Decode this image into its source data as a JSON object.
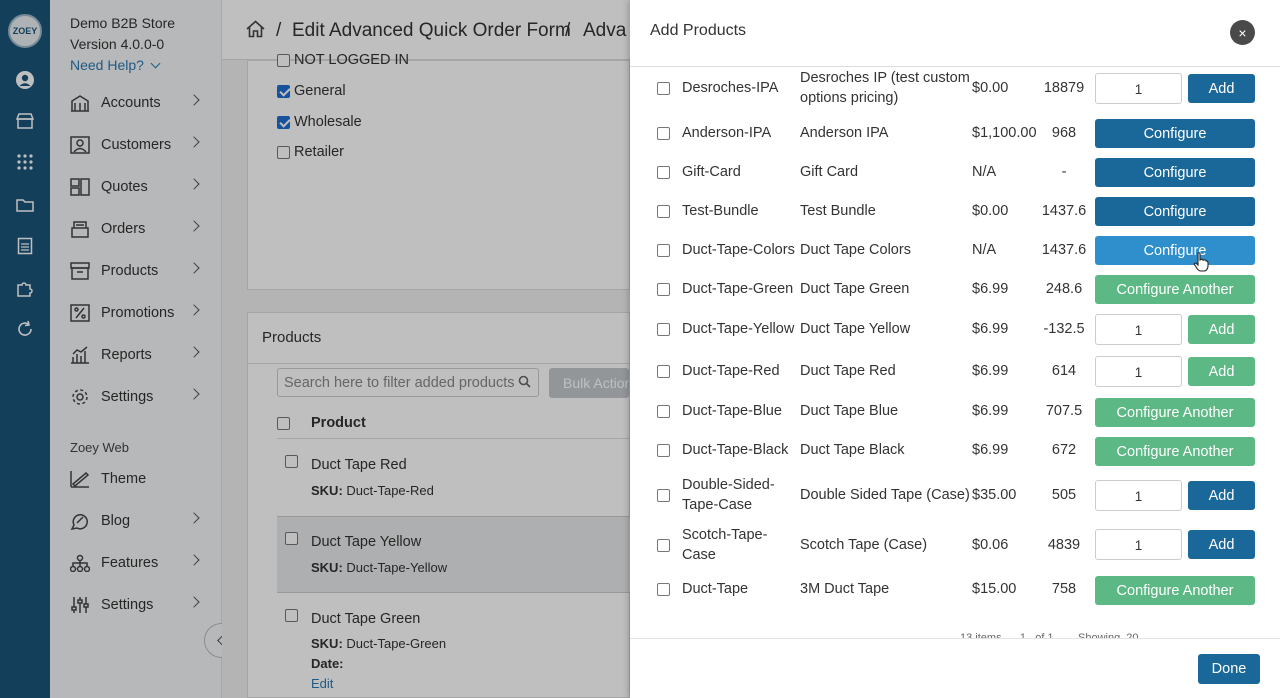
{
  "sidebar": {
    "store_name": "Demo B2B Store",
    "version": "Version 4.0.0-0",
    "help": "Need Help?",
    "logo_text": "ZOEY",
    "nav": [
      {
        "label": "Accounts",
        "icon": "accounts-icon"
      },
      {
        "label": "Customers",
        "icon": "customers-icon"
      },
      {
        "label": "Quotes",
        "icon": "quotes-icon"
      },
      {
        "label": "Orders",
        "icon": "orders-icon"
      },
      {
        "label": "Products",
        "icon": "products-icon"
      },
      {
        "label": "Promotions",
        "icon": "promotions-icon"
      },
      {
        "label": "Reports",
        "icon": "reports-icon"
      },
      {
        "label": "Settings",
        "icon": "settings-icon"
      }
    ],
    "web_section": "Zoey Web",
    "web_nav": [
      {
        "label": "Theme",
        "icon": "theme-icon"
      },
      {
        "label": "Blog",
        "icon": "blog-icon"
      },
      {
        "label": "Features",
        "icon": "features-icon"
      },
      {
        "label": "Settings",
        "icon": "sliders-icon"
      }
    ]
  },
  "breadcrumb": {
    "sep": "/",
    "page": "Edit Advanced Quick Order Form",
    "sub": "Adva"
  },
  "groups": {
    "items": [
      {
        "label": "NOT LOGGED IN",
        "checked": false
      },
      {
        "label": "General",
        "checked": true
      },
      {
        "label": "Wholesale",
        "checked": true
      },
      {
        "label": "Retailer",
        "checked": false
      }
    ]
  },
  "products_card": {
    "title": "Products",
    "search_placeholder": "Search here to filter added products",
    "bulk": "Bulk Actions",
    "column": "Product",
    "rows": [
      {
        "name": "Duct Tape Red",
        "sku_label": "SKU:",
        "sku": "Duct-Tape-Red"
      },
      {
        "name": "Duct Tape Yellow",
        "sku_label": "SKU:",
        "sku": "Duct-Tape-Yellow"
      },
      {
        "name": "Duct Tape Green",
        "sku_label": "SKU:",
        "sku": "Duct-Tape-Green",
        "date_label": "Date:",
        "edit": "Edit"
      }
    ]
  },
  "modal": {
    "title": "Add Products",
    "close": "×",
    "done": "Done",
    "pager_text": "13 items      1   of 1        Showing  20",
    "rows": [
      {
        "sku": "Desroches-IPA",
        "name": "Desroches IP (test custom options pricing)",
        "price": "$0.00",
        "qty": "18879",
        "input": "1",
        "action": "Add",
        "style": "dark"
      },
      {
        "sku": "Anderson-IPA",
        "name": "Anderson IPA",
        "price": "$1,100.00",
        "qty": "968",
        "action": "Configure",
        "style": "dark"
      },
      {
        "sku": "Gift-Card",
        "name": "Gift Card",
        "price": "N/A",
        "qty": "-",
        "action": "Configure",
        "style": "dark"
      },
      {
        "sku": "Test-Bundle",
        "name": "Test Bundle",
        "price": "$0.00",
        "qty": "1437.6",
        "action": "Configure",
        "style": "dark"
      },
      {
        "sku": "Duct-Tape-Colors",
        "name": "Duct Tape Colors",
        "price": "N/A",
        "qty": "1437.6",
        "action": "Configure",
        "style": "light"
      },
      {
        "sku": "Duct-Tape-Green",
        "name": "Duct Tape Green",
        "price": "$6.99",
        "qty": "248.6",
        "action": "Configure Another",
        "style": "green"
      },
      {
        "sku": "Duct-Tape-Yellow",
        "name": "Duct Tape Yellow",
        "price": "$6.99",
        "qty": "-132.5",
        "input": "1",
        "action": "Add",
        "style": "green"
      },
      {
        "sku": "Duct-Tape-Red",
        "name": "Duct Tape Red",
        "price": "$6.99",
        "qty": "614",
        "input": "1",
        "action": "Add",
        "style": "green"
      },
      {
        "sku": "Duct-Tape-Blue",
        "name": "Duct Tape Blue",
        "price": "$6.99",
        "qty": "707.5",
        "action": "Configure Another",
        "style": "green"
      },
      {
        "sku": "Duct-Tape-Black",
        "name": "Duct Tape Black",
        "price": "$6.99",
        "qty": "672",
        "action": "Configure Another",
        "style": "green"
      },
      {
        "sku": "Double-Sided-Tape-Case",
        "name": "Double Sided Tape (Case)",
        "price": "$35.00",
        "qty": "505",
        "input": "1",
        "action": "Add",
        "style": "dark"
      },
      {
        "sku": "Scotch-Tape-Case",
        "name": "Scotch Tape (Case)",
        "price": "$0.06",
        "qty": "4839",
        "input": "1",
        "action": "Add",
        "style": "dark"
      },
      {
        "sku": "Duct-Tape",
        "name": "3M Duct Tape",
        "price": "$15.00",
        "qty": "758",
        "action": "Configure Another",
        "style": "green"
      }
    ]
  },
  "colors": {
    "rail": "#1a5478",
    "primary": "#1a6899",
    "hover": "#2e8fcc",
    "success": "#5cb884"
  }
}
